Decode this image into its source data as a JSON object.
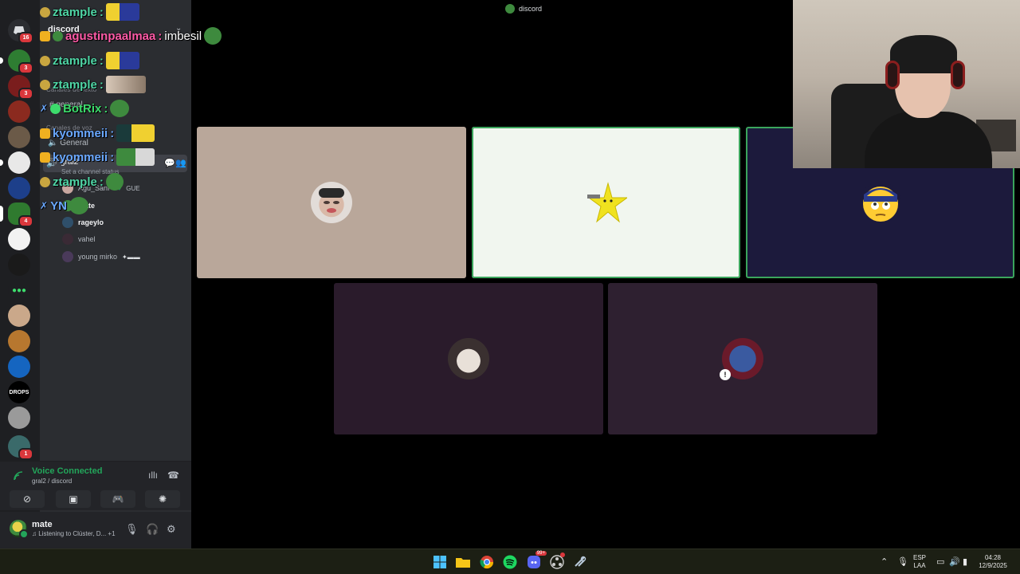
{
  "window": {
    "title": "discord"
  },
  "server_rail": {
    "badges": [
      "16",
      "3",
      "3",
      "4",
      "1"
    ],
    "drops_label": "DROPS"
  },
  "channel_panel": {
    "server_name": "discord",
    "category_text": "Canales de texto",
    "text_channel": "general",
    "category_voice": "Canales de voz",
    "voice_channel": "General",
    "selected_voice": "gral2",
    "channel_status": "Set a channel status",
    "members": [
      {
        "name": "Agu_Sanf",
        "tag": "GUE"
      },
      {
        "name": "mate",
        "tag": ""
      },
      {
        "name": "rageylo",
        "tag": ""
      },
      {
        "name": "vahel",
        "tag": ""
      },
      {
        "name": "young mirko",
        "tag": ""
      }
    ]
  },
  "voice": {
    "status": "Voice Connected",
    "location": "gral2 / discord"
  },
  "user": {
    "name": "mate",
    "activity": "Listening to Clúster, D...",
    "extra": "+1"
  },
  "chat": [
    {
      "user": "ztample",
      "color": "#4fd6a6",
      "message": ""
    },
    {
      "user": "agustinpaalmaa",
      "color": "#ff5aa7",
      "message": "imbesil"
    },
    {
      "user": "ztample",
      "color": "#4fd6a6",
      "message": ""
    },
    {
      "user": "ztample",
      "color": "#4fd6a6",
      "message": ""
    },
    {
      "user": "BotRix",
      "color": "#3ddc6c",
      "message": ""
    },
    {
      "user": "kyommeii",
      "color": "#6aa8ff",
      "message": ""
    },
    {
      "user": "kyommeii",
      "color": "#6aa8ff",
      "message": ""
    },
    {
      "user": "ztample",
      "color": "#4fd6a6",
      "message": ""
    },
    {
      "user": "YN",
      "color": "#6aa8ff",
      "message": ""
    }
  ],
  "taskbar": {
    "lang_top": "ESP",
    "lang_bottom": "LAA",
    "time": "04:28",
    "date": "12/9/2025",
    "discord_badge": "99+"
  },
  "colors": {
    "speaking": "#3ba55c",
    "voice_connected": "#23a55a",
    "tile_1": "#b9a79a",
    "tile_2": "#f1f6ef",
    "tile_3": "#1c1a3c",
    "tile_4": "#2a1b2b",
    "tile_5": "#2e2030"
  }
}
